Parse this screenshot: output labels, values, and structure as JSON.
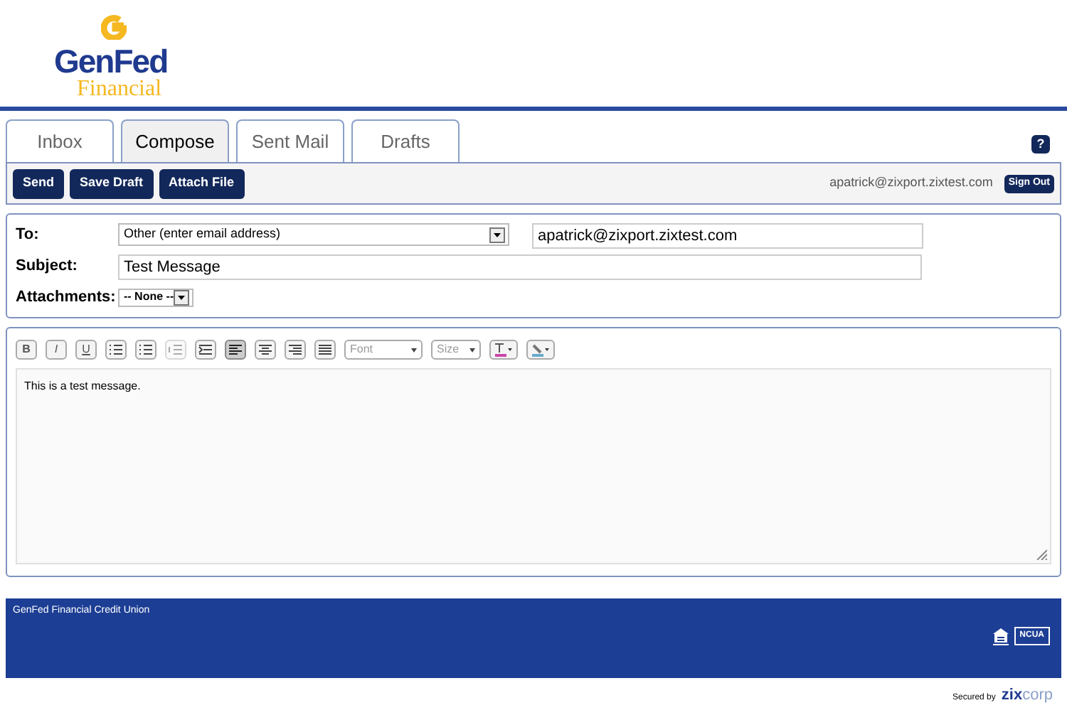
{
  "logo": {
    "name": "GenFed",
    "sub": "Financial"
  },
  "tabs": [
    {
      "label": "Inbox",
      "selected": false
    },
    {
      "label": "Compose",
      "selected": true
    },
    {
      "label": "Sent Mail",
      "selected": false
    },
    {
      "label": "Drafts",
      "selected": false
    }
  ],
  "help": "?",
  "actions": [
    "Send",
    "Save Draft",
    "Attach File"
  ],
  "user": "apatrick@zixport.zixtest.com",
  "sign_out": "Sign Out",
  "form": {
    "to_label": "To:",
    "to_select": "Other (enter email address)",
    "to_value": "apatrick@zixport.zixtest.com",
    "subject_label": "Subject:",
    "subject_value": "Test Message",
    "attachments_label": "Attachments:",
    "attachments_value": "-- None --"
  },
  "editor_tools": [
    {
      "kind": "char",
      "label": "B",
      "pressed": false,
      "disabled": false
    },
    {
      "kind": "char",
      "label": "I",
      "pressed": false,
      "disabled": false
    },
    {
      "kind": "char",
      "label": "U",
      "pressed": false,
      "disabled": false
    },
    {
      "kind": "ordered-list",
      "pressed": false,
      "disabled": false
    },
    {
      "kind": "bullet-list",
      "pressed": false,
      "disabled": false
    },
    {
      "kind": "outdent",
      "pressed": false,
      "disabled": true
    },
    {
      "kind": "indent",
      "pressed": false,
      "disabled": false
    },
    {
      "kind": "align-left",
      "pressed": true,
      "disabled": false
    },
    {
      "kind": "align-center",
      "pressed": false,
      "disabled": false
    },
    {
      "kind": "align-right",
      "pressed": false,
      "disabled": false
    },
    {
      "kind": "justify",
      "pressed": false,
      "disabled": false
    },
    {
      "kind": "dropdown",
      "label": "Font",
      "pressed": false,
      "disabled": false
    },
    {
      "kind": "dropdown",
      "label": "Size",
      "pressed": false,
      "disabled": false
    },
    {
      "kind": "text-color",
      "pressed": false,
      "disabled": false
    },
    {
      "kind": "highlight",
      "pressed": false,
      "disabled": false
    }
  ],
  "message": "This is a test message.",
  "footer": {
    "text": "GenFed Financial Credit Union",
    "ncua": "NCUA"
  },
  "secured": {
    "label": "Secured by",
    "brand_a": "zix",
    "brand_b": "corp"
  }
}
